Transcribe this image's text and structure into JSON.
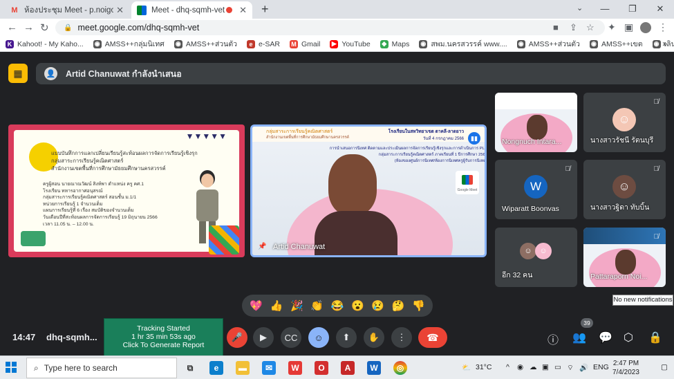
{
  "browser": {
    "tabs": [
      {
        "title": "ห้องประชุม Meet - p.noigor@gmai",
        "active": false
      },
      {
        "title": "Meet - dhq-sqmh-vet",
        "active": true
      }
    ],
    "url": "meet.google.com/dhq-sqmh-vet",
    "bookmarks": [
      {
        "label": "Kahoot! - My Kaho...",
        "color": "#46178f",
        "glyph": "K"
      },
      {
        "label": "AMSS++กลุ่มนิเทศ",
        "color": "#555555",
        "glyph": "◉"
      },
      {
        "label": "AMSS++ส่วนตัว",
        "color": "#555555",
        "glyph": "◉"
      },
      {
        "label": "e-SAR",
        "color": "#c0392b",
        "glyph": "e"
      },
      {
        "label": "Gmail",
        "color": "#ea4335",
        "glyph": "M"
      },
      {
        "label": "YouTube",
        "color": "#ff0000",
        "glyph": "▶"
      },
      {
        "label": "Maps",
        "color": "#34a853",
        "glyph": "◆"
      },
      {
        "label": "สพม.นครสวรรค์ www....",
        "color": "#555555",
        "glyph": "◉"
      },
      {
        "label": "AMSS++ส่วนตัว",
        "color": "#555555",
        "glyph": "◉"
      },
      {
        "label": "AMSS++เขต",
        "color": "#555555",
        "glyph": "◉"
      },
      {
        "label": "เลินเดือน",
        "color": "#555555",
        "glyph": "◉"
      }
    ]
  },
  "meet": {
    "presenter_banner": "Artid Chanuwat กำลังนำเสนอ",
    "slide": {
      "title_lines": [
        "แบบบันทึกการแลกเปลี่ยนเรียนรู้สะท้อนผลการจัดการเรียนรู้เชิงรุก",
        "กลุ่มสาระการเรียนรู้คณิตศาสตร์",
        "สำนักงานเขตพื้นที่การศึกษามัธยมศึกษานครสวรรค์"
      ],
      "body_lines": [
        "ครูผู้สอน นายณาณวัฒน์ สิงห์พา ตำแหน่ง ครู คศ.1",
        "โรงเรียน ทหารอากาศอนุสรณ์",
        "กลุ่มสาระการเรียนรู้คณิตศาสตร์ สอนชั้น ม.1/1",
        "หน่วยการเรียนรู้ 1 จำนวนเต็ม",
        "แผนการเรียนรู้ที่ 6 เรื่อง สมบัติของจำนวนเต็ม",
        "วันเดือนปีที่สะท้อนผลการจัดการเรียนรู้ 19 มิถุนายน 2566",
        "เวลา 11.05 น. – 12.00 น."
      ]
    },
    "speaker": {
      "name": "Artid Chanuwat",
      "header_left": "กลุ่มสาระการเรียนรู้คณิตศาสตร์",
      "header_sub": "สำนักงานเขตพื้นที่การศึกษามัธยมศึกษานครสวรรค์",
      "header_right": "โรงเรียนในสหวิทยาเขต ตาคลี-ลาดยาว",
      "header_right2": "วันที่ 4 กรกฎาคม 2566",
      "text_lines": [
        "การนำเสนอการนิเทศ ติดตามและประเมินผลการจัดการเรียนรู้เชิงรุกและการดำเนินการ PLC",
        "กลุ่มสาระการเรียนรู้คณิตศาสตร์ ภาคเรียนที่ 1 ปีการศึกษา 2566",
        "(ห้องของศูนย์การนิเทศ/ห้องการนิเทศครูผู้รับการนิเทศ)"
      ],
      "logo_label": "Google Meet"
    },
    "participants": [
      {
        "name": "Nongnuch Intara...",
        "type": "video",
        "muted": false
      },
      {
        "name": "นางสาวรัชนี รัตนบุรี",
        "type": "avatar",
        "avatar_color": "#f4c7b5",
        "avatar_glyph": "☺",
        "muted": true
      },
      {
        "name": "Wiparatt Boonvas",
        "type": "avatar",
        "avatar_color": "#1565c0",
        "avatar_glyph": "W",
        "muted": true
      },
      {
        "name": "นางสาวฐิดา ทับบิ้น",
        "type": "avatar",
        "avatar_color": "#6d4c41",
        "avatar_glyph": "☺",
        "muted": true
      },
      {
        "name": "อีก 32 คน",
        "type": "group",
        "muted": false
      },
      {
        "name": "Pattaraporn Noi...",
        "type": "video",
        "muted": true
      }
    ],
    "reactions": [
      "💖",
      "👍",
      "🎉",
      "👏",
      "😂",
      "😮",
      "😢",
      "🤔",
      "👎"
    ],
    "time": "14:47",
    "meeting_code": "dhq-sqmh...",
    "tracking": {
      "line1": "Tracking Started",
      "line2": "1 hr 35 min 53s ago",
      "line3": "Click To Generate Report"
    },
    "participant_count": "39",
    "notification_tooltip": "No new notifications"
  },
  "taskbar": {
    "search_placeholder": "Type here to search",
    "weather": "31°C",
    "lang": "ENG",
    "time": "2:47 PM",
    "date": "7/4/2023"
  },
  "colors": {
    "accent_blue": "#8ab4f8",
    "hangup_red": "#ea4335",
    "tracking_green": "#1a7f5a",
    "meet_bg": "#202124"
  }
}
